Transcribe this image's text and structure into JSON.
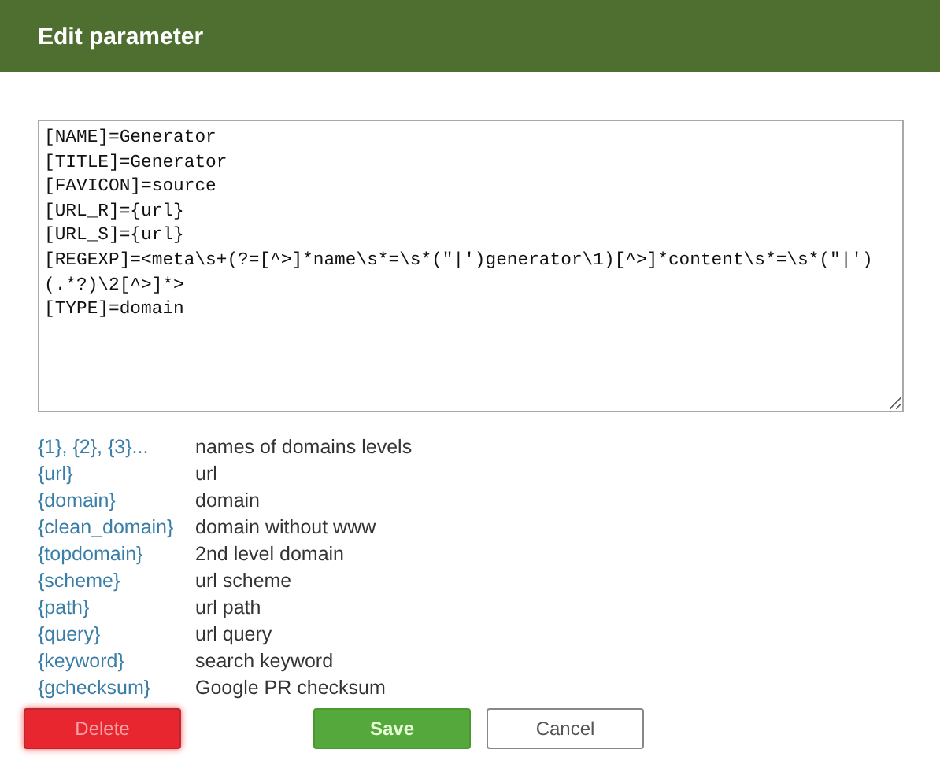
{
  "dialog": {
    "title": "Edit parameter"
  },
  "editor": {
    "lines": [
      "[NAME]=Generator",
      "[TITLE]=Generator",
      "[FAVICON]=source",
      "[URL_R]={url}",
      "[URL_S]={url}",
      "[REGEXP]=<meta\\s+(?=[^>]*name\\s*=\\s*(\"|')generator\\1)[^>]*content\\s*=\\s*(\"|')(.*?)\\2[^>]*>",
      "[TYPE]=domain"
    ]
  },
  "legend": [
    {
      "token": "{1}, {2}, {3}...",
      "meaning": "names of domains levels"
    },
    {
      "token": "{url}",
      "meaning": "url"
    },
    {
      "token": "{domain}",
      "meaning": "domain"
    },
    {
      "token": "{clean_domain}",
      "meaning": "domain without www"
    },
    {
      "token": "{topdomain}",
      "meaning": "2nd level domain"
    },
    {
      "token": "{scheme}",
      "meaning": "url scheme"
    },
    {
      "token": "{path}",
      "meaning": "url path"
    },
    {
      "token": "{query}",
      "meaning": "url query"
    },
    {
      "token": "{keyword}",
      "meaning": "search keyword"
    },
    {
      "token": "{gchecksum}",
      "meaning": "Google PR checksum"
    }
  ],
  "buttons": [
    {
      "kind": "danger",
      "label": "Delete"
    },
    {
      "kind": "primary",
      "label": "Save"
    },
    {
      "kind": "secondary",
      "label": "Cancel"
    }
  ]
}
